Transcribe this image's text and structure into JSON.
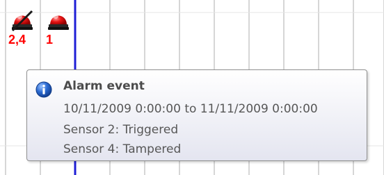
{
  "colors": {
    "grid_line": "#d6d6d6",
    "current_time_line": "#1f1fd6",
    "marker_label": "#ff0000",
    "alarm_red": "#e81515",
    "tooltip_border": "#8f8f8f",
    "info_icon_blue": "#2b6ad1"
  },
  "timeline": {
    "markers": [
      {
        "icon": "alarm-beacon-icon-muted",
        "label": "2,4"
      },
      {
        "icon": "alarm-beacon-icon",
        "label": "1"
      }
    ]
  },
  "tooltip": {
    "icon": "info-icon",
    "title": "Alarm event",
    "lines": [
      "10/11/2009 0:00:00 to 11/11/2009 0:00:00",
      "Sensor 2: Triggered",
      "Sensor 4: Tampered"
    ]
  }
}
